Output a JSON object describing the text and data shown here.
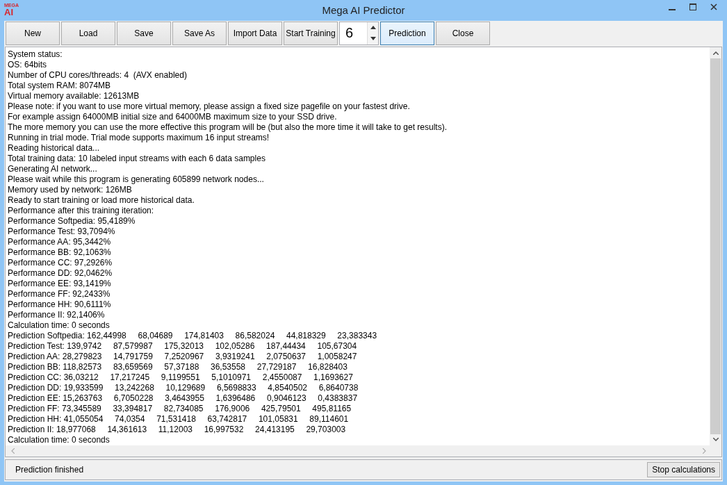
{
  "window": {
    "title": "Mega AI Predictor",
    "logo_top": "MEGA",
    "logo_main": "AI"
  },
  "toolbar": {
    "buttons_before": [
      {
        "label": "New",
        "focused": false
      },
      {
        "label": "Load",
        "focused": false
      },
      {
        "label": "Save",
        "focused": false
      },
      {
        "label": "Save As",
        "focused": false
      },
      {
        "label": "Import Data",
        "focused": false
      },
      {
        "label": "Start Training",
        "focused": false
      }
    ],
    "spinner": {
      "value": "6"
    },
    "buttons_after": [
      {
        "label": "Prediction",
        "focused": true
      },
      {
        "label": "Close",
        "focused": false
      }
    ]
  },
  "log": [
    "System status:",
    "OS: 64bits",
    "Number of CPU cores/threads: 4  (AVX enabled)",
    "Total system RAM: 8074MB",
    "Virtual memory available: 12613MB",
    "Please note: if you want to use more virtual memory, please assign a fixed size pagefile on your fastest drive.",
    "For example assign 64000MB initial size and 64000MB maximum size to your SSD drive.",
    "The more memory you can use the more effective this program will be (but also the more time it will take to get results).",
    "Running in trial mode. Trial mode supports maximum 16 input streams!",
    "Reading historical data...",
    "Total training data: 10 labeled input streams with each 6 data samples",
    "Generating AI network...",
    "Please wait while this program is generating 605899 network nodes...",
    "Memory used by network: 126MB",
    "Ready to start training or load more historical data.",
    "Performance after this training iteration:",
    "Performance Softpedia: 95,4189%",
    "Performance Test: 93,7094%",
    "Performance AA: 95,3442%",
    "Performance BB: 92,1063%",
    "Performance CC: 97,2926%",
    "Performance DD: 92,0462%",
    "Performance EE: 93,1419%",
    "Performance FF: 92,2433%",
    "Performance HH: 90,6111%",
    "Performance II: 92,1406%",
    "Calculation time: 0 seconds",
    "Prediction Softpedia: 162,44998     68,04689     174,81403     86,582024     44,818329     23,383343",
    "Prediction Test: 139,9742     87,579987     175,32013     102,05286     187,44434     105,67304",
    "Prediction AA: 28,279823     14,791759     7,2520967     3,9319241     2,0750637     1,0058247",
    "Prediction BB: 118,82573     83,659569     57,37188     36,53558     27,729187     16,828403",
    "Prediction CC: 36,03212     17,217245     9,1199551     5,1010971     2,4550087     1,1693627",
    "Prediction DD: 19,933599     13,242268     10,129689     6,5698833     4,8540502     6,8640738",
    "Prediction EE: 15,263763     6,7050228     3,4643955     1,6396486     0,9046123     0,4383837",
    "Prediction FF: 73,345589     33,394817     82,734085     176,9006     425,79501     495,81165",
    "Prediction HH: 41,055054     74,0354     71,531418     63,742817     101,05831     89,114601",
    "Prediction II: 18,977068     14,361613     11,12003     16,997532     24,413195     29,703003",
    "Calculation time: 0 seconds"
  ],
  "status_bar": {
    "message": "Prediction finished",
    "button": "Stop calculations"
  }
}
